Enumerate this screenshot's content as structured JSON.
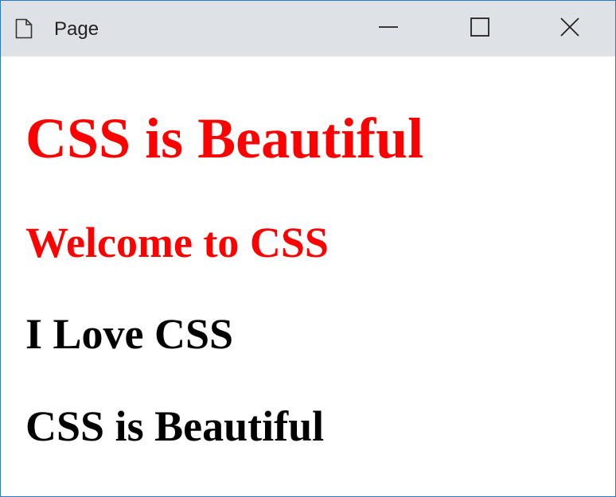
{
  "window": {
    "title": "Page",
    "icon": "page-document-icon",
    "controls": {
      "minimize_icon": "minimize-icon",
      "maximize_icon": "maximize-icon",
      "close_icon": "close-icon"
    }
  },
  "content": {
    "headings": [
      {
        "text": "CSS is Beautiful",
        "color": "#ff0000"
      },
      {
        "text": "Welcome to CSS",
        "color": "#ff0000"
      },
      {
        "text": "I Love CSS",
        "color": "#000000"
      },
      {
        "text": "CSS is Beautiful",
        "color": "#000000"
      }
    ]
  },
  "colors": {
    "titlebar_bg": "#dee1e6",
    "window_border": "#2b79c2",
    "accent_red": "#ff0000",
    "text_black": "#000000"
  }
}
